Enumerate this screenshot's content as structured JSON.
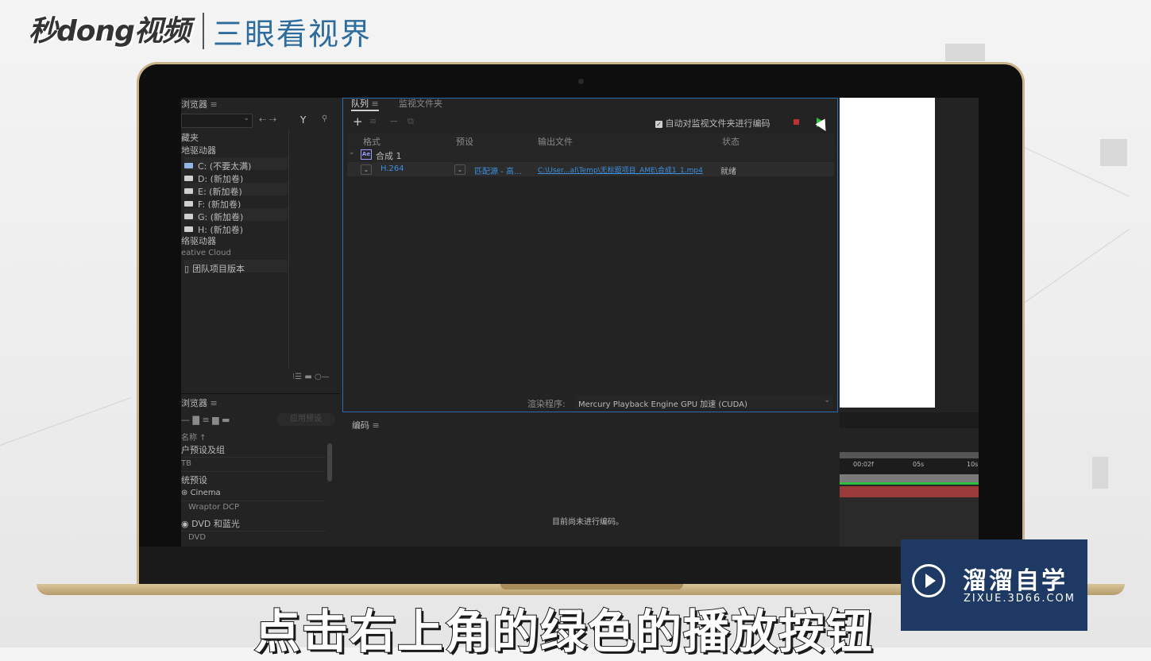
{
  "brand": {
    "logo": "秒dong视频",
    "subtitle": "三眼看视界"
  },
  "left_panel": {
    "title": "浏览器",
    "menu_icon": "≡",
    "sections": {
      "favorites": "藏夹",
      "local_drives": "地驱动器",
      "network": "络驱动器",
      "cloud": "eative Cloud",
      "team": "团队项目版本"
    },
    "drives": [
      "C: (不要太满)",
      "D: (新加卷)",
      "E: (新加卷)",
      "F: (新加卷)",
      "G: (新加卷)",
      "H: (新加卷)"
    ]
  },
  "presets_panel": {
    "title": "浏览器",
    "apply_button": "应用预设",
    "name_header": "名称 ↑",
    "items": [
      "户预设及组",
      "TB",
      "统预设",
      "Cinema",
      "Wraptor DCP",
      "DVD 和蓝光",
      "DVD"
    ]
  },
  "queue": {
    "tab_queue": "队列",
    "tab_watch": "监视文件夹",
    "auto_encode_label": "自动对监视文件夹进行编码",
    "columns": [
      "格式",
      "预设",
      "输出文件",
      "状态"
    ],
    "comp_name": "合成 1",
    "item": {
      "format": "H.264",
      "preset": "匹配源 - 高...",
      "output": "C:\\User...al\\Temp\\无标题项目_AME\\合成1_1.mp4",
      "status": "就绪"
    },
    "renderer_label": "渲染程序:",
    "renderer_value": "Mercury Playback Engine GPU 加速 (CUDA)"
  },
  "encode_panel": {
    "title": "编码",
    "empty_message": "目前尚未进行编码。"
  },
  "timeline": {
    "ticks": [
      "00:02f",
      "05s",
      "10s"
    ]
  },
  "subtitle": "点击右上角的绿色的播放按钮",
  "watermark": {
    "title": "溜溜自学",
    "url": "ZIXUE.3D66.COM"
  },
  "colors": {
    "accent_blue": "#2b6bb0",
    "play_green": "#2fbf3f",
    "stop_red": "#c03030"
  }
}
